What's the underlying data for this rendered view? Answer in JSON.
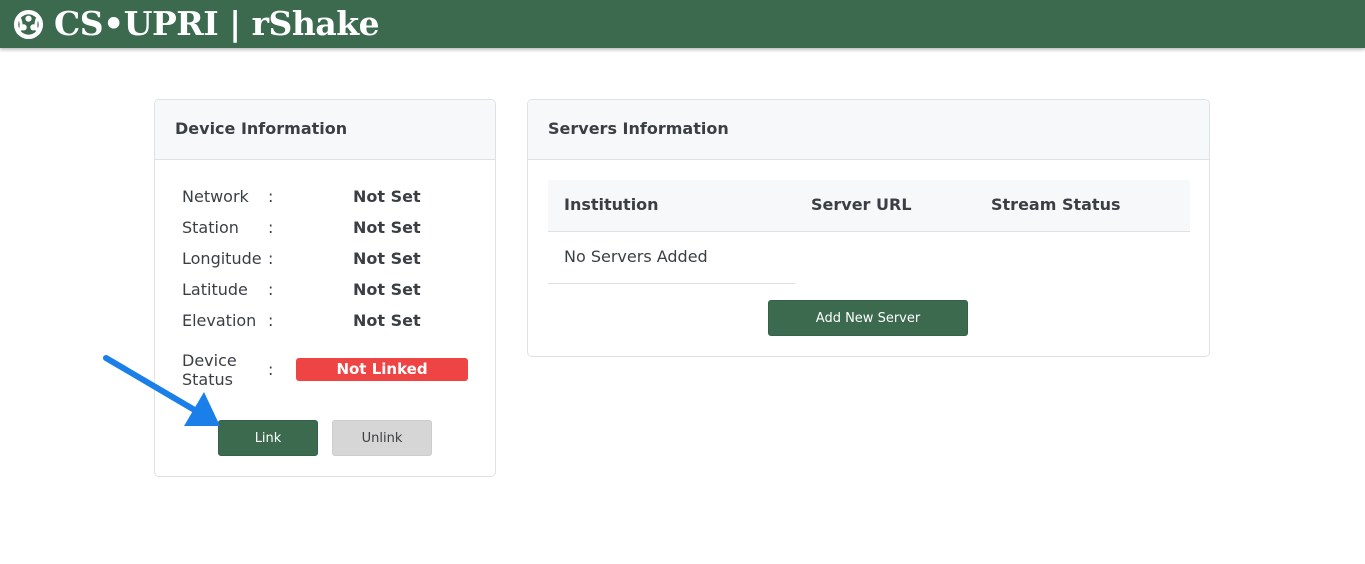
{
  "header": {
    "brand": "CS•UPRI | rShake",
    "logo_icon": "seismic-logo-icon",
    "bar_color": "#3b6a4f"
  },
  "device_card": {
    "title": "Device Information",
    "rows": [
      {
        "label": "Network",
        "colon": ":",
        "value": "Not Set"
      },
      {
        "label": "Station",
        "colon": ":",
        "value": "Not Set"
      },
      {
        "label": "Longitude",
        "colon": ":",
        "value": "Not Set"
      },
      {
        "label": "Latitude",
        "colon": ":",
        "value": "Not Set"
      },
      {
        "label": "Elevation",
        "colon": ":",
        "value": "Not Set"
      }
    ],
    "status_label_line1": "Device",
    "status_label_line2": "Status",
    "status_colon": ":",
    "status_value": "Not Linked",
    "status_color": "#ef4444",
    "link_label": "Link",
    "unlink_label": "Unlink"
  },
  "servers_card": {
    "title": "Servers Information",
    "columns": [
      "Institution",
      "Server URL",
      "Stream Status"
    ],
    "empty_message": "No Servers Added",
    "add_label": "Add New Server"
  },
  "annotation": {
    "arrow_icon": "arrow-pointer-icon",
    "arrow_color": "#1a7fe8"
  }
}
